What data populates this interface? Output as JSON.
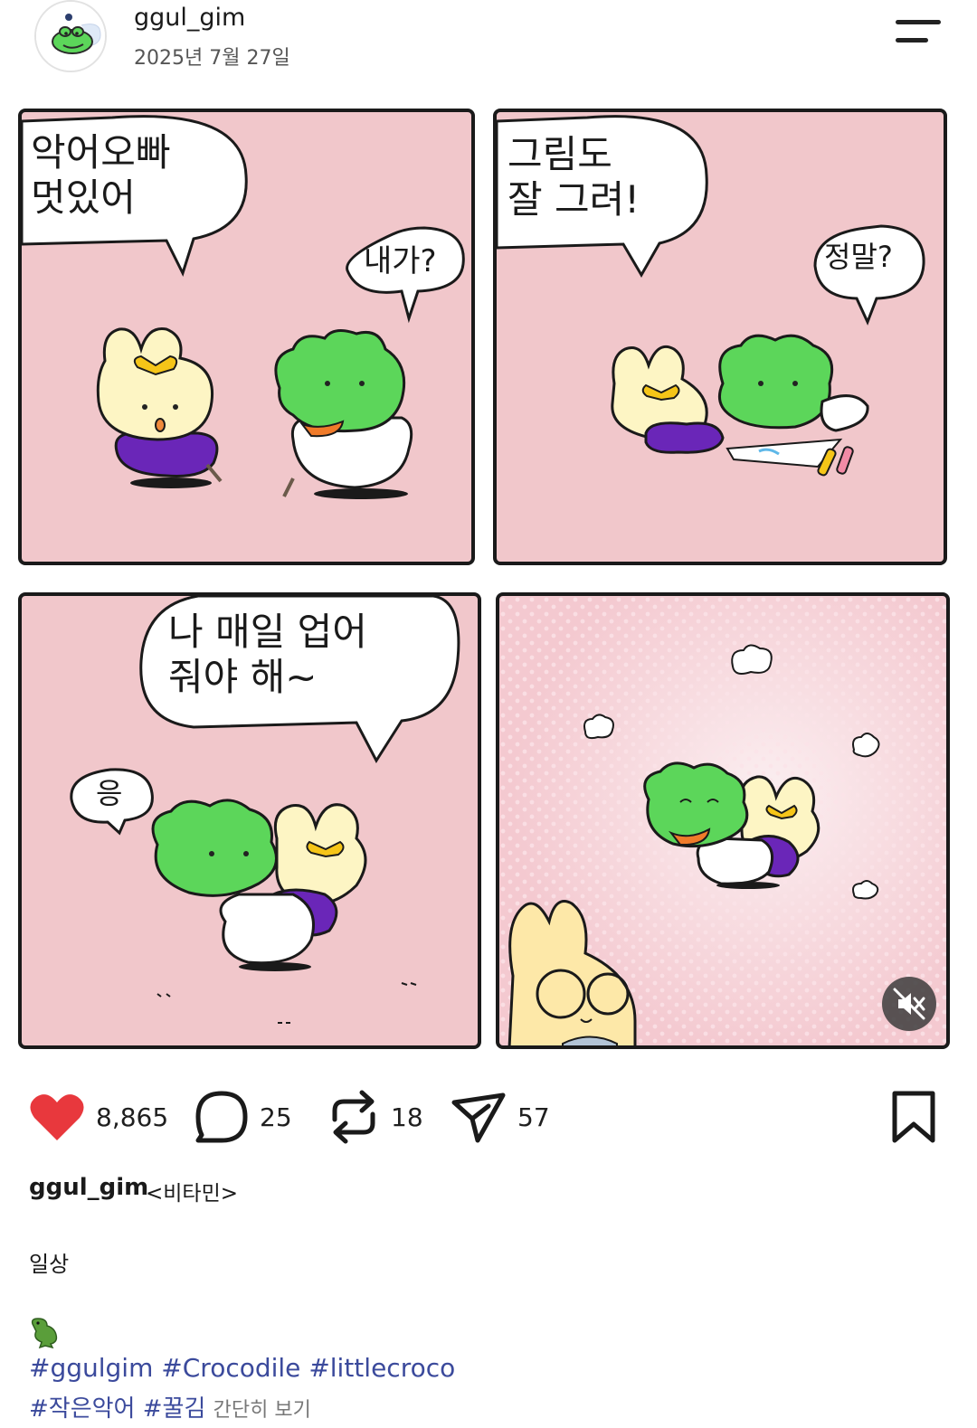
{
  "header": {
    "username": "ggul_gim",
    "date": "2025년 7월 27일",
    "avatar_icon": "crocodile-avatar",
    "menu_icon": "menu-icon"
  },
  "comic": {
    "panel1": {
      "bubble_big": "악어오빠\n멋있어",
      "bubble_small": "내가?"
    },
    "panel2": {
      "bubble_big": "그림도\n잘 그려!",
      "bubble_small": "정말?"
    },
    "panel3": {
      "bubble_big": "나 매일 업어\n줘야 해~",
      "bubble_small": "응"
    },
    "panel4": {},
    "mute_icon": "mute-icon"
  },
  "actions": {
    "likes": "8,865",
    "comments": "25",
    "reposts": "18",
    "shares": "57",
    "like_color": "#e8383d"
  },
  "caption": {
    "username": "ggul_gim",
    "suffix": "<비타민>",
    "body": "일상",
    "emoji_icon": "crocodile-emoji",
    "tags_line1": [
      "#ggulgim",
      "#Crocodile",
      "#littlecroco"
    ],
    "tags_line2": [
      "#작은악어",
      "#꿀김"
    ],
    "more": "간단히 보기"
  }
}
